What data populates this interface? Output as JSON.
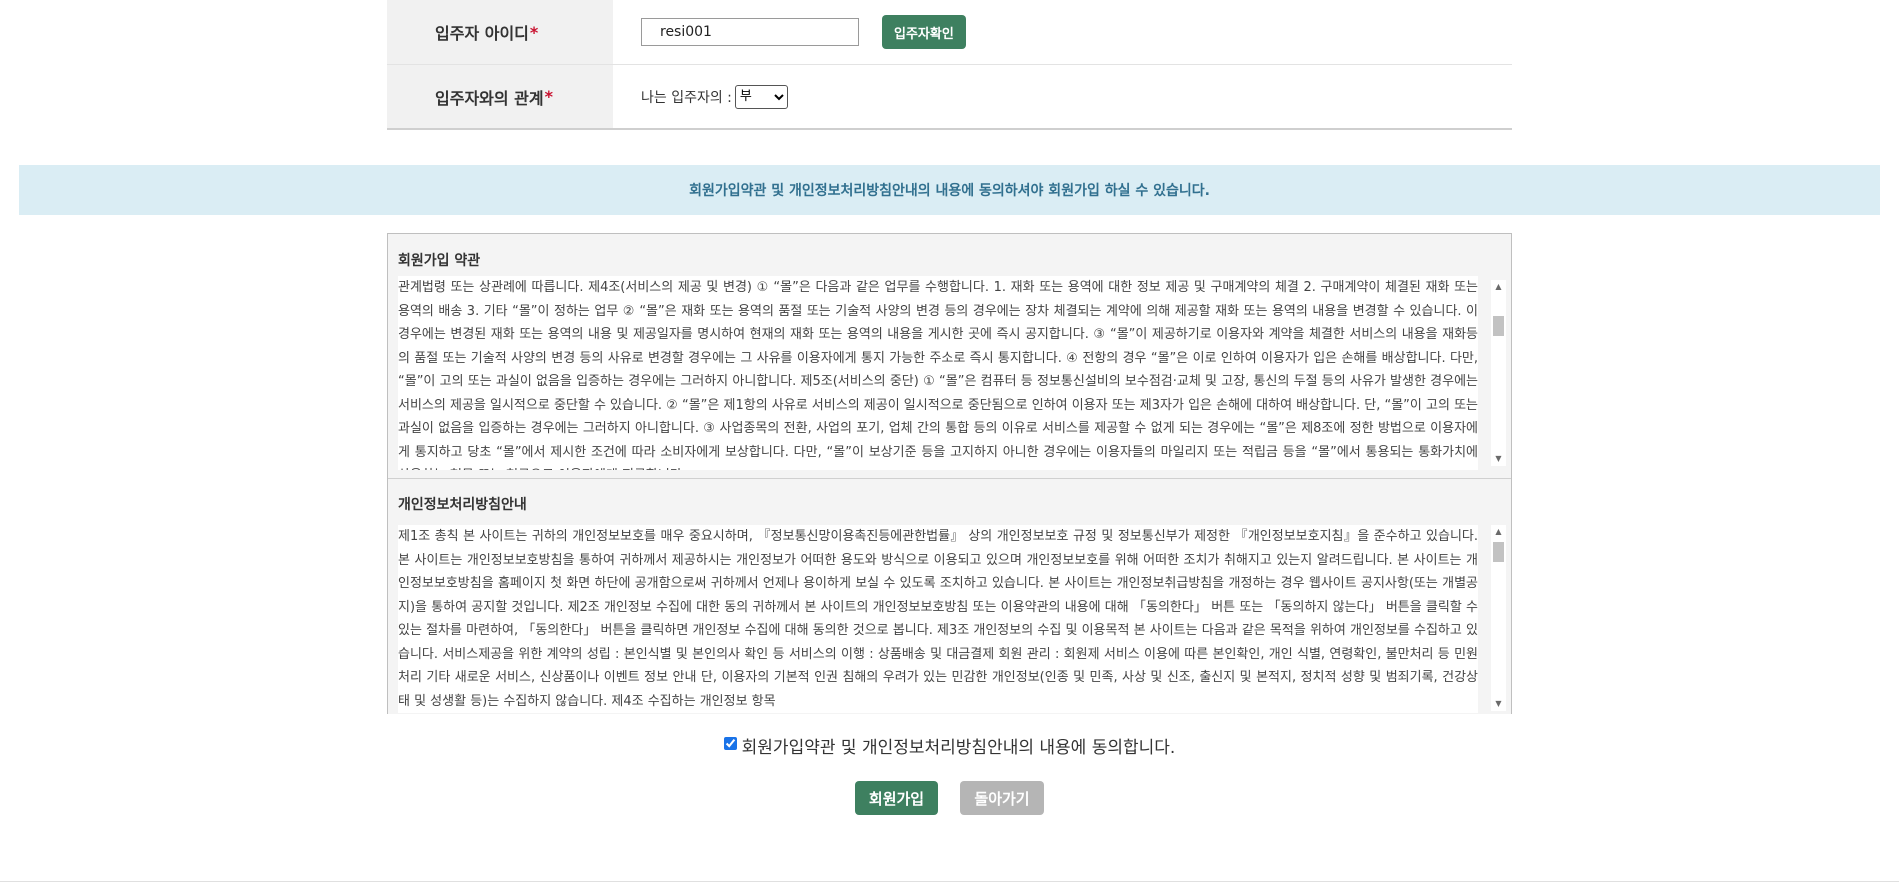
{
  "form": {
    "resident_id": {
      "label": "입주자 아이디",
      "required_mark": "*",
      "value": "resi001",
      "check_button": "입주자확인"
    },
    "relation": {
      "label": "입주자와의 관계",
      "required_mark": "*",
      "prefix": "나는 입주자의 :",
      "selected": "부"
    }
  },
  "notice": "회원가입약관 및 개인정보처리방침안내의 내용에 동의하셔야 회원가입 하실 수 있습니다.",
  "terms": {
    "title": "회원가입 약관",
    "text": "관계법령 또는 상관례에 따릅니다. 제4조(서비스의 제공 및 변경) ① “몰”은 다음과 같은 업무를 수행합니다. 1. 재화 또는 용역에 대한 정보 제공 및 구매계약의 체결 2. 구매계약이 체결된 재화 또는 용역의 배송 3. 기타 “몰”이 정하는 업무 ② “몰”은 재화 또는 용역의 품절 또는 기술적 사양의 변경 등의 경우에는 장차 체결되는 계약에 의해 제공할 재화 또는 용역의 내용을 변경할 수 있습니다. 이 경우에는 변경된 재화 또는 용역의 내용 및 제공일자를 명시하여 현재의 재화 또는 용역의 내용을 게시한 곳에 즉시 공지합니다. ③ “몰”이 제공하기로 이용자와 계약을 체결한 서비스의 내용을 재화등의 품절 또는 기술적 사양의 변경 등의 사유로 변경할 경우에는 그 사유를 이용자에게 통지 가능한 주소로 즉시 통지합니다. ④ 전항의 경우 “몰”은 이로 인하여 이용자가 입은 손해를 배상합니다. 다만, “몰”이 고의 또는 과실이 없음을 입증하는 경우에는 그러하지 아니합니다. 제5조(서비스의 중단) ① “몰”은 컴퓨터 등 정보통신설비의 보수점검·교체 및 고장, 통신의 두절 등의 사유가 발생한 경우에는 서비스의 제공을 일시적으로 중단할 수 있습니다. ② “몰”은 제1항의 사유로 서비스의 제공이 일시적으로 중단됨으로 인하여 이용자 또는 제3자가 입은 손해에 대하여 배상합니다. 단, “몰”이 고의 또는 과실이 없음을 입증하는 경우에는 그러하지 아니합니다. ③ 사업종목의 전환, 사업의 포기, 업체 간의 통합 등의 이유로 서비스를 제공할 수 없게 되는 경우에는 “몰”은 제8조에 정한 방법으로 이용자에게 통지하고 당초 “몰”에서 제시한 조건에 따라 소비자에게 보상합니다. 다만, “몰”이 보상기준 등을 고지하지 아니한 경우에는 이용자들의 마일리지 또는 적립금 등을 “몰”에서 통용되는 통화가치에 상응하는 현물 또는 현금으로 이용자에게 지급합니다."
  },
  "privacy": {
    "title": "개인정보처리방침안내",
    "text": "제1조 총칙 본 사이트는 귀하의 개인정보보호를 매우 중요시하며, 『정보통신망이용촉진등에관한법률』 상의 개인정보보호 규정 및 정보통신부가 제정한 『개인정보보호지침』을 준수하고 있습니다. 본 사이트는 개인정보보호방침을 통하여 귀하께서 제공하시는 개인정보가 어떠한 용도와 방식으로 이용되고 있으며 개인정보보호를 위해 어떠한 조치가 취해지고 있는지 알려드립니다. 본 사이트는 개인정보보호방침을 홈페이지 첫 화면 하단에 공개함으로써 귀하께서 언제나 용이하게 보실 수 있도록 조치하고 있습니다. 본 사이트는 개인정보취급방침을 개정하는 경우 웹사이트 공지사항(또는 개별공지)을 통하여 공지할 것입니다. 제2조 개인정보 수집에 대한 동의 귀하께서 본 사이트의 개인정보보호방침 또는 이용약관의 내용에 대해 「동의한다」 버튼 또는 「동의하지 않는다」 버튼을 클릭할 수 있는 절차를 마련하여, 「동의한다」 버튼을 클릭하면 개인정보 수집에 대해 동의한 것으로 봅니다. 제3조 개인정보의 수집 및 이용목적 본 사이트는 다음과 같은 목적을 위하여 개인정보를 수집하고 있습니다. 서비스제공을 위한 계약의 성립 : 본인식별 및 본인의사 확인 등 서비스의 이행 : 상품배송 및 대금결제 회원 관리 : 회원제 서비스 이용에 따른 본인확인, 개인 식별, 연령확인, 불만처리 등 민원처리 기타 새로운 서비스, 신상품이나 이벤트 정보 안내 단, 이용자의 기본적 인권 침해의 우려가 있는 민감한 개인정보(인종 및 민족, 사상 및 신조, 출신지 및 본적지, 정치적 성향 및 범죄기록, 건강상태 및 성생활 등)는 수집하지 않습니다. 제4조 수집하는 개인정보 항목"
  },
  "agree": {
    "label": "회원가입약관 및 개인정보처리방침안내의 내용에 동의합니다.",
    "checked": true
  },
  "buttons": {
    "submit": "회원가입",
    "back": "돌아가기"
  }
}
